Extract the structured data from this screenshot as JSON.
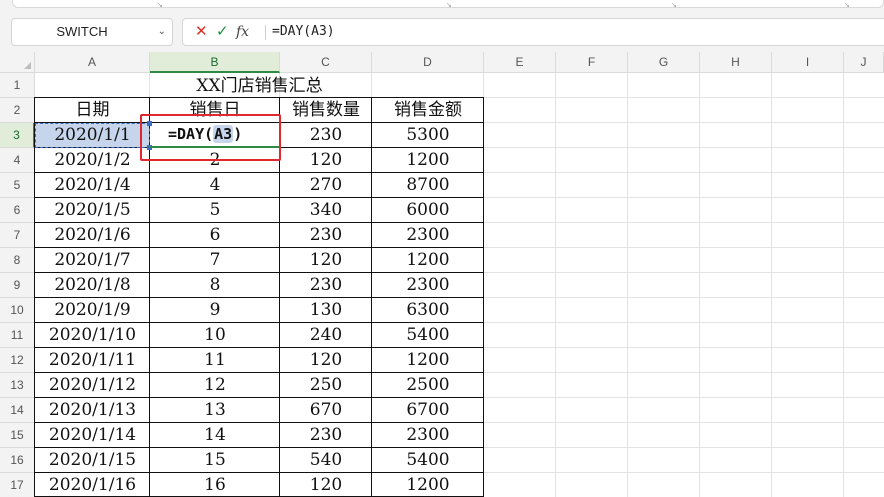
{
  "formula_bar": {
    "name_box": "SWITCH",
    "cancel_icon": "close-icon",
    "confirm_icon": "check-icon",
    "fx_label": "fx",
    "formula": "=DAY(A3)"
  },
  "columns": [
    "A",
    "B",
    "C",
    "D",
    "E",
    "F",
    "G",
    "H",
    "I",
    "J"
  ],
  "rows": [
    "1",
    "2",
    "3",
    "4",
    "5",
    "6",
    "7",
    "8",
    "9",
    "10",
    "11",
    "12",
    "13",
    "14",
    "15",
    "16",
    "17"
  ],
  "table": {
    "title": "XX门店销售汇总",
    "headers": [
      "日期",
      "销售日",
      "销售数量",
      "销售金额"
    ],
    "editing_formula": {
      "prefix": "=DAY(",
      "ref": "A3",
      "suffix": ")"
    },
    "rows": [
      [
        "2020/1/1",
        "",
        "230",
        "5300"
      ],
      [
        "2020/1/2",
        "2",
        "120",
        "1200"
      ],
      [
        "2020/1/4",
        "4",
        "270",
        "8700"
      ],
      [
        "2020/1/5",
        "5",
        "340",
        "6000"
      ],
      [
        "2020/1/6",
        "6",
        "230",
        "2300"
      ],
      [
        "2020/1/7",
        "7",
        "120",
        "1200"
      ],
      [
        "2020/1/8",
        "8",
        "230",
        "2300"
      ],
      [
        "2020/1/9",
        "9",
        "130",
        "6300"
      ],
      [
        "2020/1/10",
        "10",
        "240",
        "5400"
      ],
      [
        "2020/1/11",
        "11",
        "120",
        "1200"
      ],
      [
        "2020/1/12",
        "12",
        "250",
        "2500"
      ],
      [
        "2020/1/13",
        "13",
        "670",
        "6700"
      ],
      [
        "2020/1/14",
        "14",
        "230",
        "2300"
      ],
      [
        "2020/1/15",
        "15",
        "540",
        "5400"
      ],
      [
        "2020/1/16",
        "16",
        "120",
        "1200"
      ]
    ]
  },
  "colors": {
    "active_header": "#e1ecd9",
    "reference_highlight": "#c7d5ec",
    "annotation_box": "#e0282e"
  }
}
